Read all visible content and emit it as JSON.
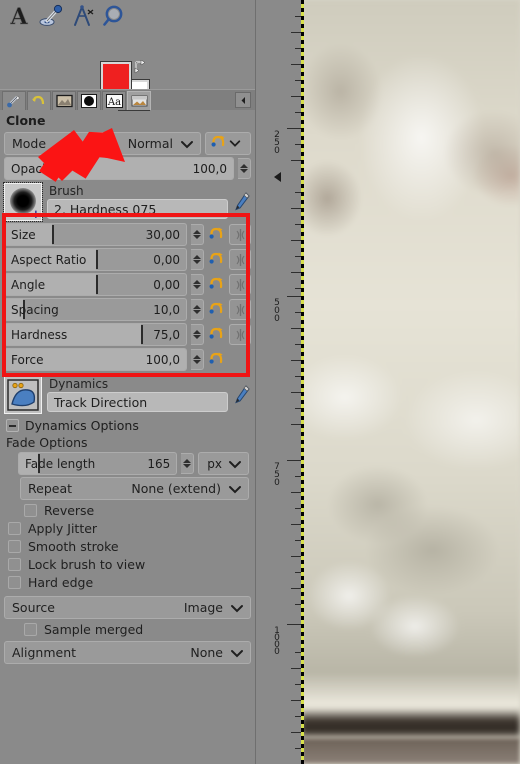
{
  "app": {
    "dock_title": "Clone"
  },
  "toolbar": {
    "tools": [
      {
        "name": "text-tool",
        "label": "Text"
      },
      {
        "name": "color-picker-tool",
        "label": "Color Picker"
      },
      {
        "name": "measure-tool",
        "label": "Measure"
      },
      {
        "name": "zoom-tool",
        "label": "Zoom"
      }
    ]
  },
  "colors": {
    "foreground": "#ef2020",
    "background": "#ffffff",
    "swap_label": "Swap colors",
    "reset_label": "Reset colors"
  },
  "tabs": [
    {
      "name": "tool-options",
      "label": "Tool Options",
      "selected": false
    },
    {
      "name": "undo-history",
      "label": "Undo History",
      "selected": false
    },
    {
      "name": "images",
      "label": "Images",
      "selected": false
    },
    {
      "name": "brushes",
      "label": "Brushes",
      "selected": false
    },
    {
      "name": "fonts",
      "label": "Fonts",
      "selected": false
    },
    {
      "name": "document-history",
      "label": "Document History",
      "selected": true
    }
  ],
  "tab_menu_label": "Configure this tab",
  "options": {
    "mode": {
      "label": "Mode",
      "value": "Normal"
    },
    "mode_reset_label": "Reset to default values",
    "opacity": {
      "label": "Opacity",
      "value": "100,0",
      "percent": 100
    },
    "brush": {
      "section_label": "Brush",
      "value": "2. Hardness 075",
      "thumb_label": "brush preview"
    },
    "sliders": [
      {
        "name": "size",
        "label": "Size",
        "value": "30,00",
        "fill_percent": 26,
        "has_link": true
      },
      {
        "name": "aspect-ratio",
        "label": "Aspect Ratio",
        "value": "0,00",
        "fill_percent": 50,
        "has_link": true
      },
      {
        "name": "angle",
        "label": "Angle",
        "value": "0,00",
        "fill_percent": 50,
        "has_link": true
      },
      {
        "name": "spacing",
        "label": "Spacing",
        "value": "10,0",
        "fill_percent": 10,
        "has_link": true
      },
      {
        "name": "hardness",
        "label": "Hardness",
        "value": "75,0",
        "fill_percent": 75,
        "has_link": true
      },
      {
        "name": "force",
        "label": "Force",
        "value": "100,0",
        "fill_percent": 100,
        "has_link": false
      }
    ],
    "dynamics": {
      "section_label": "Dynamics",
      "value": "Track Direction",
      "options_expander": "Dynamics Options"
    },
    "fade": {
      "section_label": "Fade Options",
      "length_label": "Fade length",
      "length_value": "165",
      "unit": "px",
      "repeat_label": "Repeat",
      "repeat_value": "None (extend)",
      "reverse_label": "Reverse",
      "reverse_checked": false
    },
    "checkboxes": [
      {
        "name": "apply-jitter",
        "label": "Apply Jitter",
        "checked": false
      },
      {
        "name": "smooth-stroke",
        "label": "Smooth stroke",
        "checked": false
      },
      {
        "name": "lock-brush-to-view",
        "label": "Lock brush to view",
        "checked": false
      },
      {
        "name": "hard-edge",
        "label": "Hard edge",
        "checked": false
      }
    ],
    "source": {
      "label": "Source",
      "value": "Image"
    },
    "sample_merged": {
      "label": "Sample merged",
      "checked": false
    },
    "alignment": {
      "label": "Alignment",
      "value": "None"
    }
  },
  "ruler": {
    "unit_hint": "px",
    "labels": [
      "250",
      "500",
      "750",
      "1000"
    ]
  },
  "annotations": {
    "highlight_box_label": "brush parameter sliders highlight",
    "arrow_label": "pointer to brush options",
    "accent_color": "#f01414"
  }
}
